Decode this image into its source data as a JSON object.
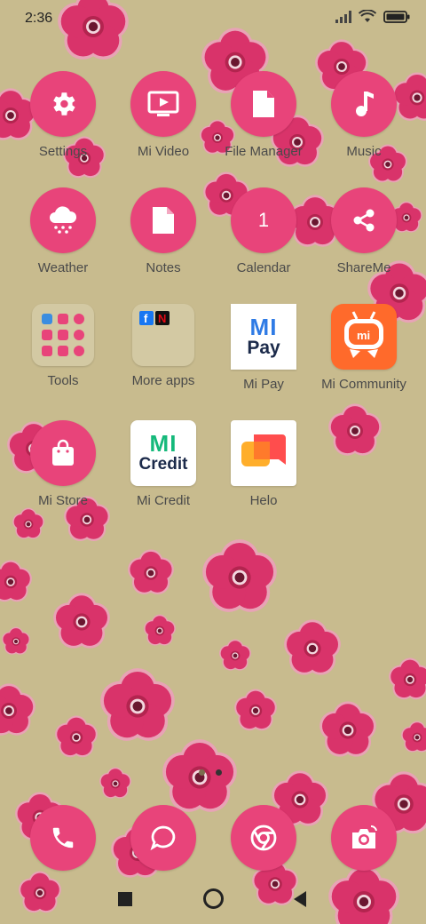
{
  "status_bar": {
    "time": "2:36",
    "icons": [
      "signal-icon",
      "wifi-icon",
      "battery-icon"
    ]
  },
  "apps": [
    {
      "label": "Settings",
      "icon": "gear-icon"
    },
    {
      "label": "Mi Video",
      "icon": "tv-icon"
    },
    {
      "label": "File Manager",
      "icon": "file-icon"
    },
    {
      "label": "Music",
      "icon": "music-note-icon"
    },
    {
      "label": "Weather",
      "icon": "cloud-snow-icon"
    },
    {
      "label": "Notes",
      "icon": "note-icon"
    },
    {
      "label": "Calendar",
      "icon": "calendar-icon",
      "day": "1"
    },
    {
      "label": "ShareMe",
      "icon": "share-icon"
    },
    {
      "label": "Tools",
      "icon": "folder-icon"
    },
    {
      "label": "More apps",
      "icon": "folder-icon"
    },
    {
      "label": "Mi Pay",
      "icon": "mi-pay-logo",
      "logo_top": "MI",
      "logo_bottom": "Pay"
    },
    {
      "label": "Mi Community",
      "icon": "mi-community-logo",
      "logo_text": "mi"
    },
    {
      "label": "Mi Store",
      "icon": "shopping-bag-icon"
    },
    {
      "label": "Mi Credit",
      "icon": "mi-credit-logo",
      "logo_top": "MI",
      "logo_bottom": "Credit"
    },
    {
      "label": "Helo",
      "icon": "helo-logo"
    }
  ],
  "dock": [
    {
      "name": "phone-icon"
    },
    {
      "name": "messages-icon"
    },
    {
      "name": "chrome-icon"
    },
    {
      "name": "camera-icon"
    }
  ],
  "colors": {
    "accent": "#e8447a",
    "background": "#c8bb8e",
    "flower": "#d9336a",
    "flower_dark": "#b3244f"
  }
}
